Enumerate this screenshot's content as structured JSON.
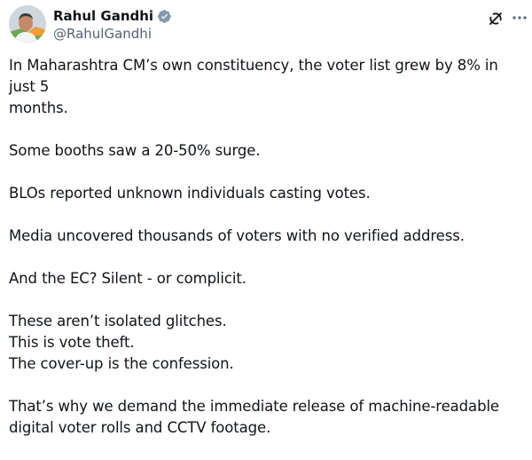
{
  "author": {
    "display_name": "Rahul Gandhi",
    "handle": "@RahulGandhi",
    "verified_color": "#829aab"
  },
  "tweet": {
    "paragraphs": [
      [
        "In Maharashtra CM’s own constituency, the voter list grew by 8% in just 5",
        "months."
      ],
      [
        "Some booths saw a 20-50% surge."
      ],
      [
        "BLOs reported unknown individuals casting votes."
      ],
      [
        "Media uncovered thousands of voters with no verified address."
      ],
      [
        "And the EC? Silent - or complicit."
      ],
      [
        "These aren’t isolated glitches.",
        "This is vote theft.",
        "The cover-up is the confession."
      ],
      [
        "That’s why we demand the immediate release of machine-readable",
        "digital voter rolls and CCTV footage."
      ]
    ]
  },
  "icons": {
    "avatar": "avatar-photo",
    "verified": "verified-badge-icon",
    "grok": "grok-icon",
    "more": "more-icon"
  }
}
